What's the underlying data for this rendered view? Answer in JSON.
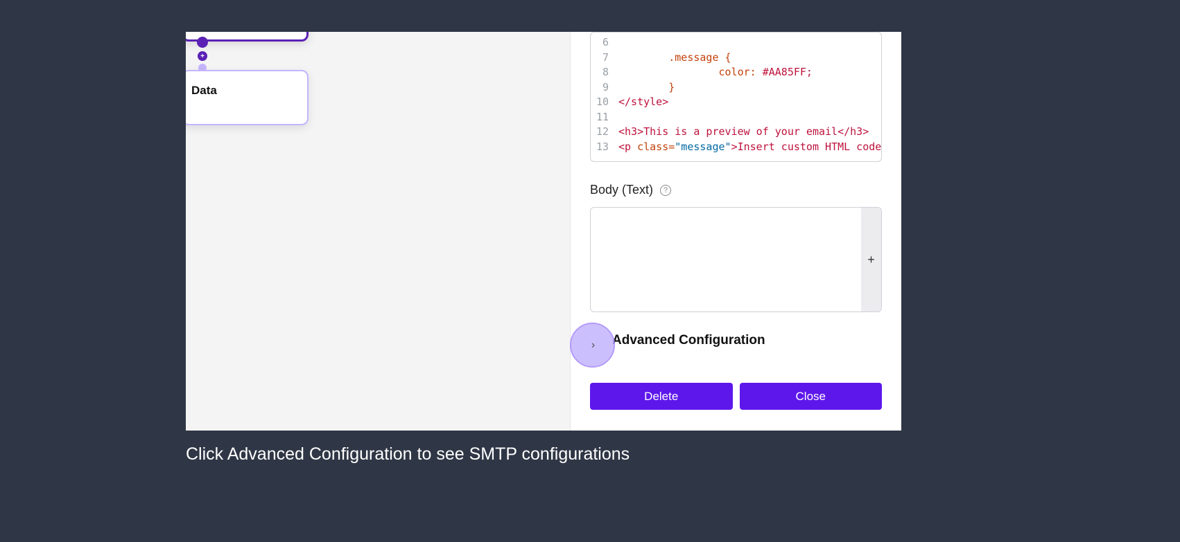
{
  "canvas": {
    "node_label": "Data",
    "plus_symbol": "+"
  },
  "editor": {
    "lines": [
      {
        "num": "6",
        "content": ""
      },
      {
        "num": "7",
        "content_class": ".message",
        "brace": " {"
      },
      {
        "num": "8",
        "content_prop": "color:",
        "content_val": " #AA85FF;"
      },
      {
        "num": "9",
        "content_brace": "}"
      },
      {
        "num": "10",
        "tag_close": "</style>"
      },
      {
        "num": "11",
        "content": ""
      },
      {
        "num": "12",
        "tag_open": "<h3>",
        "text": "This is a preview of your email",
        "tag_close2": "</h3>"
      },
      {
        "num": "13",
        "p_open": "<p ",
        "attr": "class=",
        "str": "\"message\"",
        "p_close": ">",
        "p_text": "Insert custom HTML code"
      }
    ]
  },
  "body_text": {
    "label": "Body (Text)",
    "help": "?",
    "plus": "+",
    "value": ""
  },
  "advanced": {
    "label": "Advanced Configuration",
    "chevron": "›"
  },
  "buttons": {
    "delete": "Delete",
    "close": "Close"
  },
  "caption": "Click Advanced Configuration to see SMTP configurations"
}
